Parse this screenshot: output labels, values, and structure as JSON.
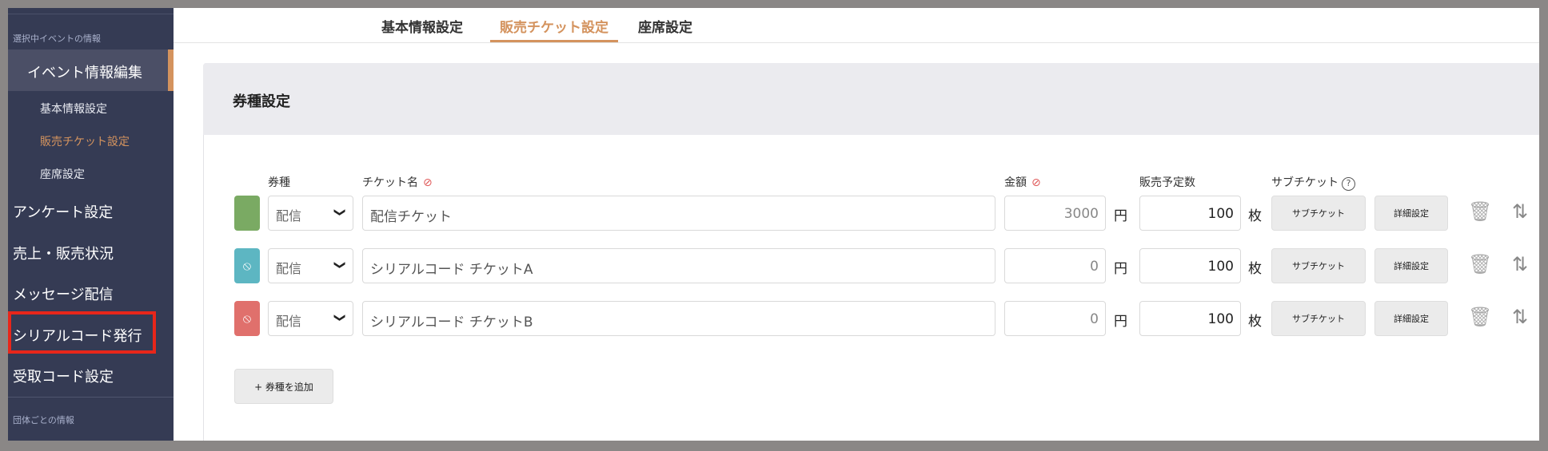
{
  "sidebar": {
    "section_event": "選択中イベントの情報",
    "active_item": "イベント情報編集",
    "sub_items": [
      "基本情報設定",
      "販売チケット設定",
      "座席設定"
    ],
    "items": [
      "アンケート設定",
      "売上・販売状況",
      "メッセージ配信",
      "シリアルコード発行",
      "受取コード設定"
    ],
    "section_group": "団体ごとの情報"
  },
  "tabs": [
    "基本情報設定",
    "販売チケット設定",
    "座席設定"
  ],
  "card": {
    "title": "券種設定",
    "headers": {
      "type": "券種",
      "name": "チケット名",
      "price": "金額",
      "quantity": "販売予定数",
      "subticket": "サブチケット"
    },
    "rows": [
      {
        "color": "#7aaa63",
        "icon": "",
        "type": "配信",
        "name": "配信チケット",
        "price": "3000",
        "yen": "円",
        "qty": "100",
        "mai": "枚",
        "sub_label": "サブチケット",
        "detail_label": "詳細設定"
      },
      {
        "color": "#5db6c2",
        "icon": "eye-slash-icon",
        "type": "配信",
        "name": "シリアルコード チケットA",
        "price": "0",
        "yen": "円",
        "qty": "100",
        "mai": "枚",
        "sub_label": "サブチケット",
        "detail_label": "詳細設定"
      },
      {
        "color": "#e0706c",
        "icon": "eye-slash-icon",
        "type": "配信",
        "name": "シリアルコード チケットB",
        "price": "0",
        "yen": "円",
        "qty": "100",
        "mai": "枚",
        "sub_label": "サブチケット",
        "detail_label": "詳細設定"
      }
    ],
    "add_label": "+ 券種を追加"
  }
}
